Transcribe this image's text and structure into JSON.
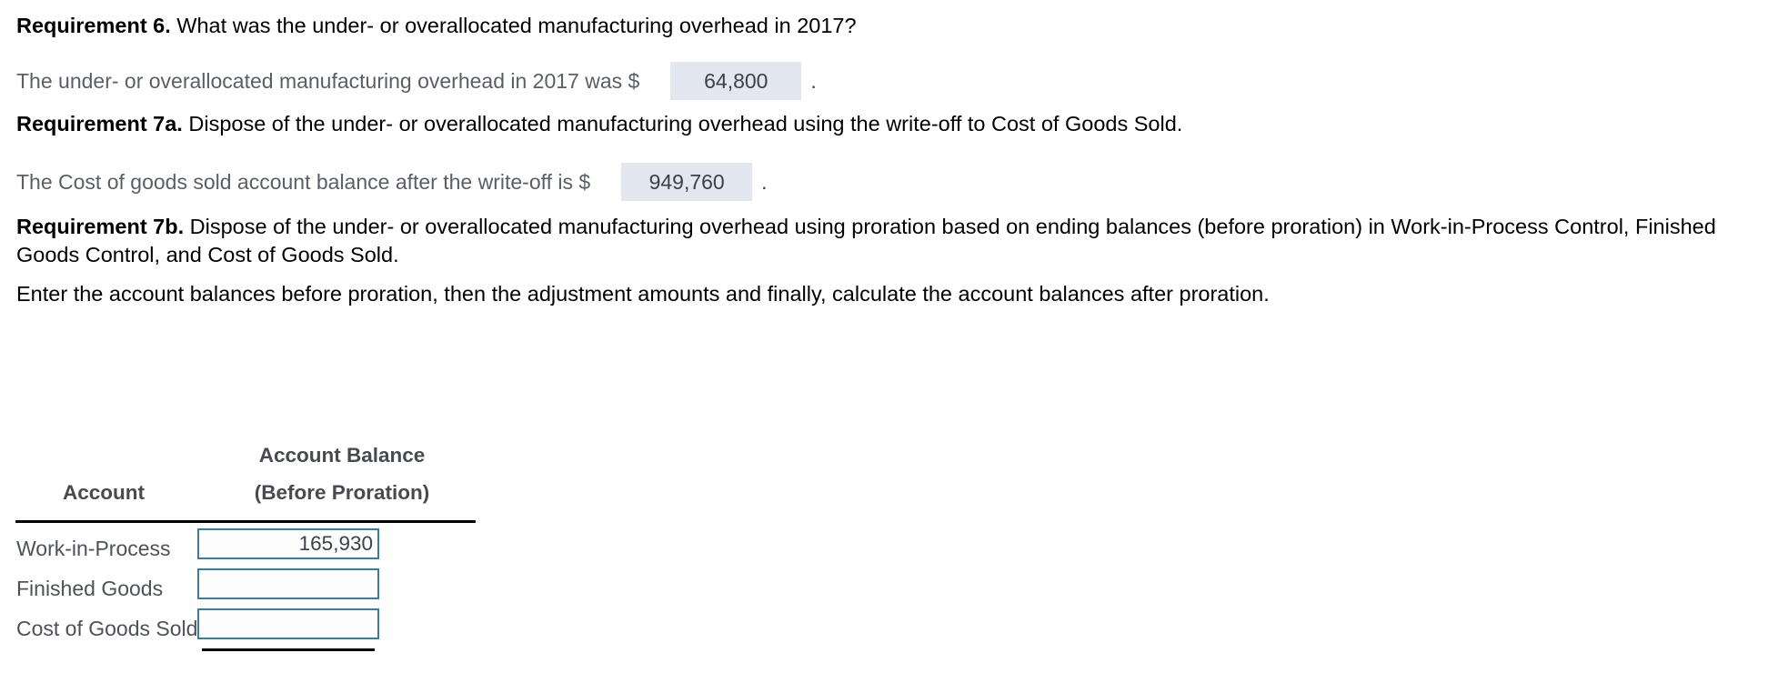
{
  "requirements": {
    "req6": {
      "label": "Requirement 6.",
      "text": " What was the under- or overallocated manufacturing overhead in 2017?"
    },
    "req6_answer": {
      "prompt": "The under- or overallocated manufacturing overhead in 2017 was $",
      "value": "64,800",
      "period": "."
    },
    "req7a": {
      "label": "Requirement 7a.",
      "text": " Dispose of the under- or overallocated manufacturing overhead using the write-off to Cost of Goods Sold."
    },
    "req7a_answer": {
      "prompt": "The Cost of goods sold account balance after the write-off is $",
      "value": "949,760",
      "period": "."
    },
    "req7b": {
      "label": "Requirement 7b.",
      "text": " Dispose of the under- or overallocated manufacturing overhead using proration based on ending balances (before proration) in Work-in-Process Control, Finished Goods Control, and Cost of Goods Sold."
    },
    "instruction": "Enter the account balances before proration, then the adjustment amounts and finally, calculate the account balances after proration."
  },
  "table": {
    "header": {
      "col1": "Account",
      "col2_line1": "Account Balance",
      "col2_line2": "(Before Proration)"
    },
    "rows": [
      {
        "account": "Work-in-Process",
        "balance": "165,930"
      },
      {
        "account": "Finished Goods",
        "balance": ""
      },
      {
        "account": "Cost of Goods Sold",
        "balance": ""
      }
    ]
  },
  "colors": {
    "answer_box_bg": "#e2e7f0",
    "input_border": "#3c7d9e",
    "header_text": "#474b50",
    "body_text": "#000000",
    "muted_text": "#5a5f66"
  }
}
